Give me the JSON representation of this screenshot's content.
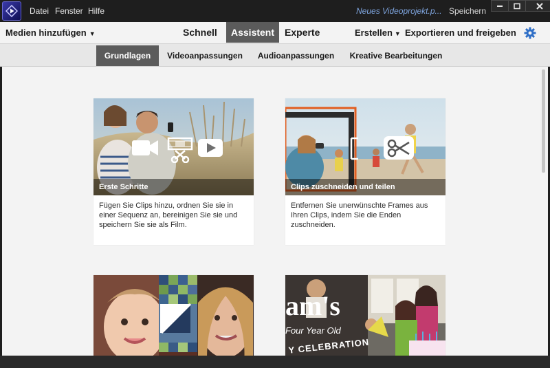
{
  "menu": {
    "items": [
      "Datei",
      "Fenster",
      "Hilfe"
    ],
    "project_title": "Neues Videoprojekt.p...",
    "save": "Speichern"
  },
  "modebar": {
    "add_media": "Medien hinzufügen",
    "tabs": [
      "Schnell",
      "Assistent",
      "Experte"
    ],
    "active_tab": "Assistent",
    "create": "Erstellen",
    "export": "Exportieren und freigeben"
  },
  "subtabs": {
    "items": [
      "Grundlagen",
      "Videoanpassungen",
      "Audioanpassungen",
      "Kreative Bearbeitungen"
    ],
    "active": "Grundlagen"
  },
  "cards": [
    {
      "title": "Erste Schritte",
      "desc": "Fügen Sie Clips hinzu, ordnen Sie sie in einer Sequenz an, bereinigen Sie sie und speichern Sie sie als Film.",
      "icons": [
        "video-camera-icon",
        "film-scissors-icon",
        "play-icon"
      ]
    },
    {
      "title": "Clips zuschneiden und teilen",
      "desc": "Entfernen Sie unerwünschte Frames aus Ihren Clips, indem Sie die Enden zuschneiden.",
      "icons": [
        "scissors-icon"
      ]
    },
    {
      "title": "",
      "desc": "",
      "icons": [
        "transition-icon"
      ]
    },
    {
      "title": "",
      "desc": "",
      "photo_text": [
        "am's",
        "Four Year Old",
        "Y CELEBRATION"
      ]
    }
  ],
  "colors": {
    "accent": "#5b5b5b",
    "project_title": "#7fa6e0",
    "gear": "#2f6fc7"
  }
}
